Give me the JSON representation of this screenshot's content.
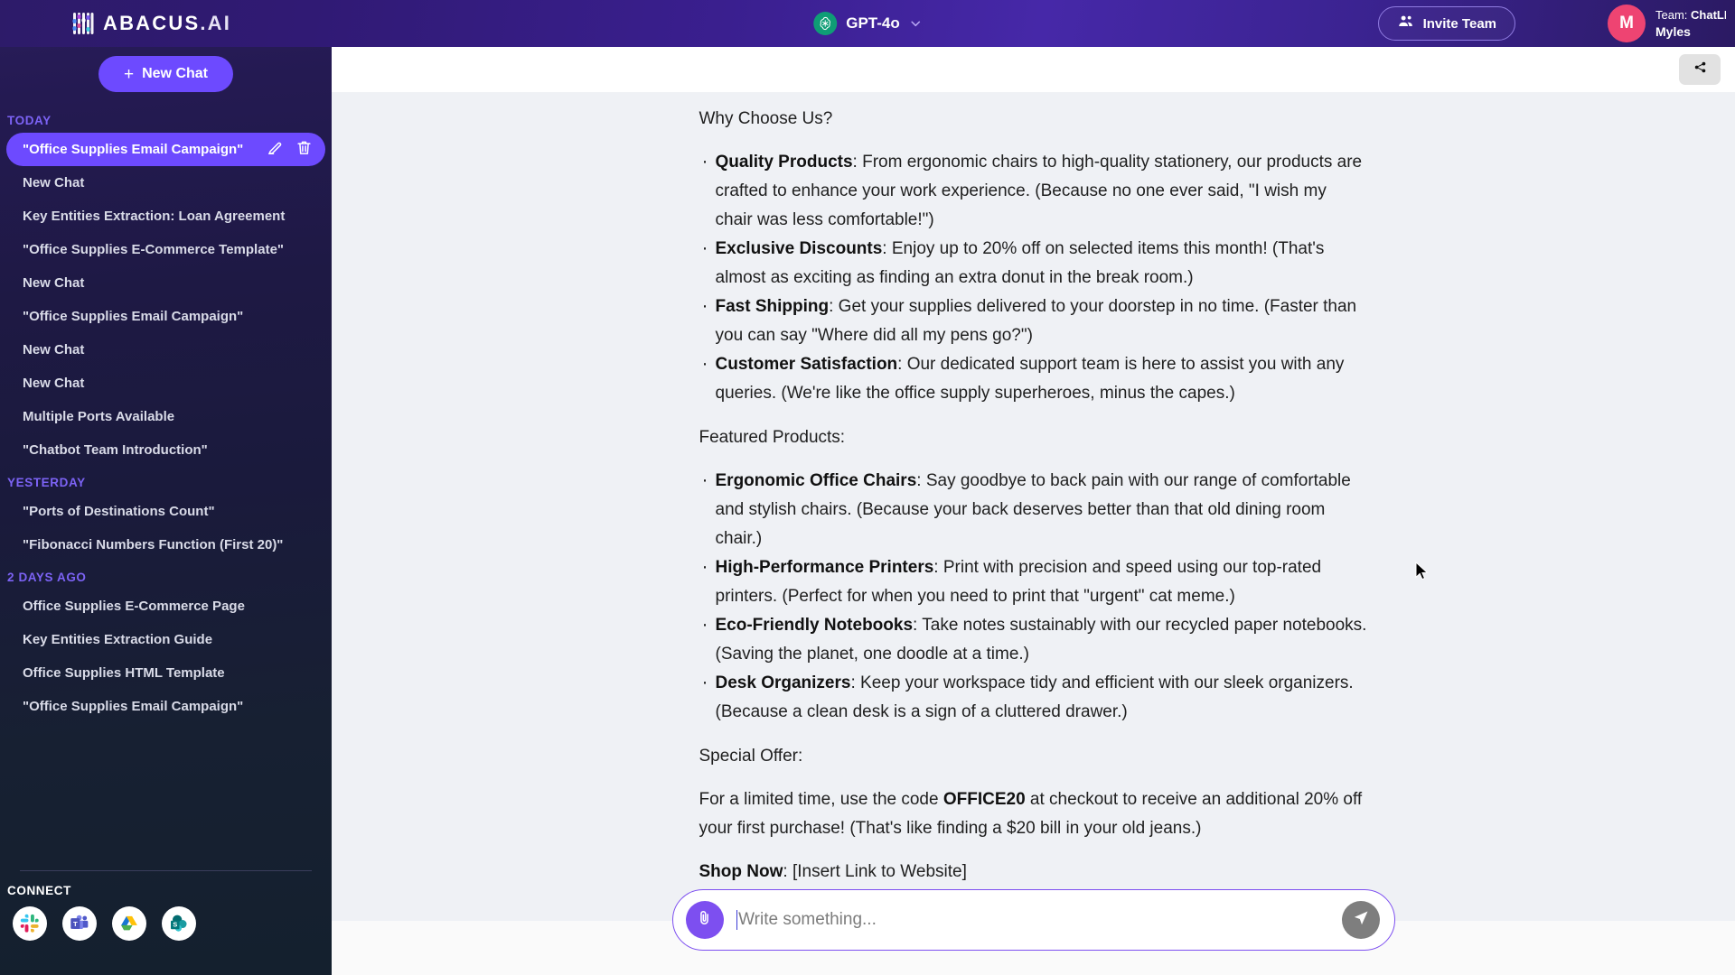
{
  "app": {
    "brand_name": "ABACUS",
    "brand_suffix": ".AI",
    "logo_icon": "abacus-logo-icon"
  },
  "header": {
    "model": {
      "name": "GPT-4o",
      "icon": "openai-logo-icon",
      "chevron_icon": "chevron-down-icon"
    },
    "invite": {
      "label": "Invite Team",
      "icon": "people-icon"
    },
    "user": {
      "avatar_initial": "M",
      "team_prefix": "Team:",
      "team_name": "ChatLL",
      "name": "Myles"
    }
  },
  "sidebar": {
    "new_chat_label": "New Chat",
    "new_chat_icon": "plus-icon",
    "groups": [
      {
        "label": "TODAY",
        "items": [
          {
            "title": "\"Office Supplies Email Campaign\"",
            "active": true
          },
          {
            "title": "New Chat",
            "active": false
          },
          {
            "title": "Key Entities Extraction: Loan Agreement",
            "active": false
          },
          {
            "title": "\"Office Supplies E-Commerce Template\"",
            "active": false
          },
          {
            "title": "New Chat",
            "active": false
          },
          {
            "title": "\"Office Supplies Email Campaign\"",
            "active": false
          },
          {
            "title": "New Chat",
            "active": false
          },
          {
            "title": "New Chat",
            "active": false
          },
          {
            "title": "Multiple Ports Available",
            "active": false
          },
          {
            "title": "\"Chatbot Team Introduction\"",
            "active": false
          }
        ]
      },
      {
        "label": "YESTERDAY",
        "items": [
          {
            "title": "\"Ports of Destinations Count\"",
            "active": false
          },
          {
            "title": "\"Fibonacci Numbers Function (First 20)\"",
            "active": false
          }
        ]
      },
      {
        "label": "2 DAYS AGO",
        "items": [
          {
            "title": "Office Supplies E-Commerce Page",
            "active": false
          },
          {
            "title": "Key Entities Extraction Guide",
            "active": false
          },
          {
            "title": "Office Supplies HTML Template",
            "active": false
          },
          {
            "title": "\"Office Supplies Email Campaign\"",
            "active": false
          }
        ]
      }
    ],
    "row_actions": {
      "edit_icon": "edit-pencil-icon",
      "delete_icon": "trash-icon"
    },
    "connect": {
      "label": "CONNECT",
      "apps": [
        {
          "name": "slack-icon"
        },
        {
          "name": "microsoft-teams-icon"
        },
        {
          "name": "google-drive-icon"
        },
        {
          "name": "sharepoint-icon"
        }
      ]
    }
  },
  "main": {
    "share_icon": "share-icon",
    "message": {
      "heading_why": "Why Choose Us?",
      "why_bullets": [
        {
          "term": "Quality Products",
          "text": ": From ergonomic chairs to high-quality stationery, our products are crafted to enhance your work experience. (Because no one ever said, \"I wish my chair was less comfortable!\")"
        },
        {
          "term": "Exclusive Discounts",
          "text": ": Enjoy up to 20% off on selected items this month! (That's almost as exciting as finding an extra donut in the break room.)"
        },
        {
          "term": "Fast Shipping",
          "text": ": Get your supplies delivered to your doorstep in no time. (Faster than you can say \"Where did all my pens go?\")"
        },
        {
          "term": "Customer Satisfaction",
          "text": ": Our dedicated support team is here to assist you with any queries. (We're like the office supply superheroes, minus the capes.)"
        }
      ],
      "heading_featured": "Featured Products:",
      "featured_bullets": [
        {
          "term": "Ergonomic Office Chairs",
          "text": ": Say goodbye to back pain with our range of comfortable and stylish chairs. (Because your back deserves better than that old dining room chair.)"
        },
        {
          "term": "High-Performance Printers",
          "text": ": Print with precision and speed using our top-rated printers. (Perfect for when you need to print that \"urgent\" cat meme.)"
        },
        {
          "term": "Eco-Friendly Notebooks",
          "text": ": Take notes sustainably with our recycled paper notebooks. (Saving the planet, one doodle at a time.)"
        },
        {
          "term": "Desk Organizers",
          "text": ": Keep your workspace tidy and efficient with our sleek organizers. (Because a clean desk is a sign of a cluttered drawer.)"
        }
      ],
      "heading_offer": "Special Offer:",
      "offer_pre": "For a limited time, use the code ",
      "offer_code": "OFFICE20",
      "offer_post": " at checkout to receive an additional 20% off your first purchase! (That's like finding a $20 bill in your old jeans.)",
      "shop_now_term": "Shop Now",
      "shop_now_text": ": [Insert Link to Website]"
    },
    "composer": {
      "placeholder": "Write something...",
      "value": "",
      "attach_icon": "paperclip-icon",
      "send_icon": "send-paper-plane-icon"
    }
  },
  "colors": {
    "accent_purple": "#6d4aff",
    "header_purple": "#3a1f8f",
    "avatar_pink": "#ee4472",
    "openai_green": "#0f9d76",
    "chat_bg": "#eff1f5"
  }
}
